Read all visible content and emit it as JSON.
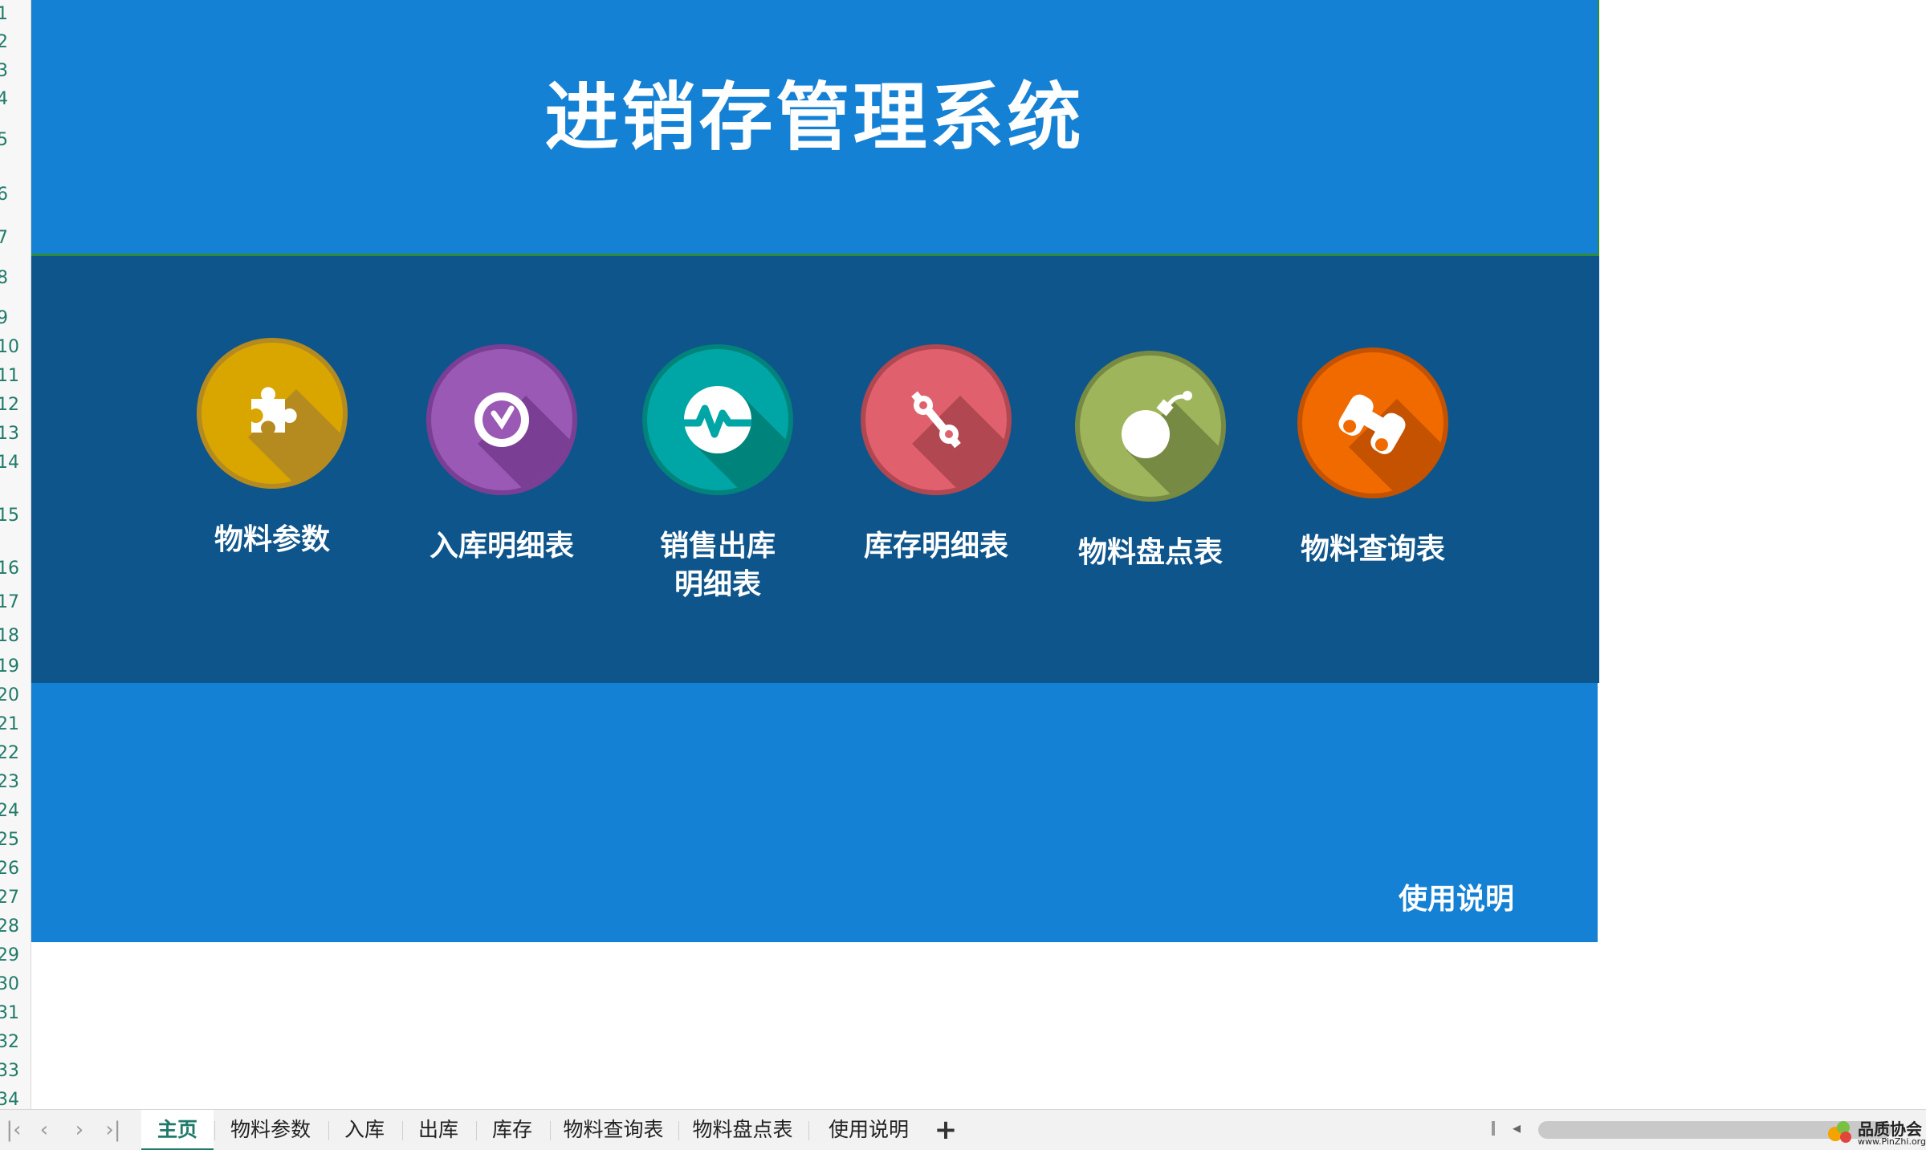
{
  "app": {
    "title": "进销存管理系统"
  },
  "row_numbers": [
    "1",
    "2",
    "3",
    "4",
    "5",
    "6",
    "7",
    "8",
    "9",
    "10",
    "11",
    "12",
    "13",
    "14",
    "15",
    "16",
    "17",
    "18",
    "19",
    "20",
    "21",
    "22",
    "23",
    "24",
    "25",
    "26",
    "27",
    "28",
    "29",
    "30",
    "31",
    "32",
    "33",
    "34"
  ],
  "menu": {
    "items": [
      {
        "label_lines": [
          "物料参数"
        ],
        "icon": "puzzle-icon",
        "color": "#d9a600",
        "shade": "#b58a1f"
      },
      {
        "label_lines": [
          "入库明细表"
        ],
        "icon": "clock-icon",
        "color": "#9b59b6",
        "shade": "#7a3f95"
      },
      {
        "label_lines": [
          "销售出库",
          "明细表"
        ],
        "icon": "pulse-icon",
        "color": "#00a6a6",
        "shade": "#00837a"
      },
      {
        "label_lines": [
          "库存明细表"
        ],
        "icon": "percent-icon",
        "color": "#e1606e",
        "shade": "#b14750"
      },
      {
        "label_lines": [
          "物料盘点表"
        ],
        "icon": "bomb-icon",
        "color": "#9fb55b",
        "shade": "#778a43"
      },
      {
        "label_lines": [
          "物料查询表"
        ],
        "icon": "binoculars-icon",
        "color": "#f06a00",
        "shade": "#c45200"
      }
    ]
  },
  "footer": {
    "help_label": "使用说明"
  },
  "sheet_tabs": {
    "active": "主页",
    "tabs": [
      "主页",
      "物料参数",
      "入库",
      "出库",
      "库存",
      "物料查询表",
      "物料盘点表",
      "使用说明"
    ],
    "add_label": "+"
  },
  "watermark": {
    "text": "品质协会",
    "url": "www.PinZhi.org"
  },
  "colors": {
    "header_blue": "#1581d4",
    "menu_navy": "#0e558c",
    "tab_active_text": "#1f7a6a"
  }
}
